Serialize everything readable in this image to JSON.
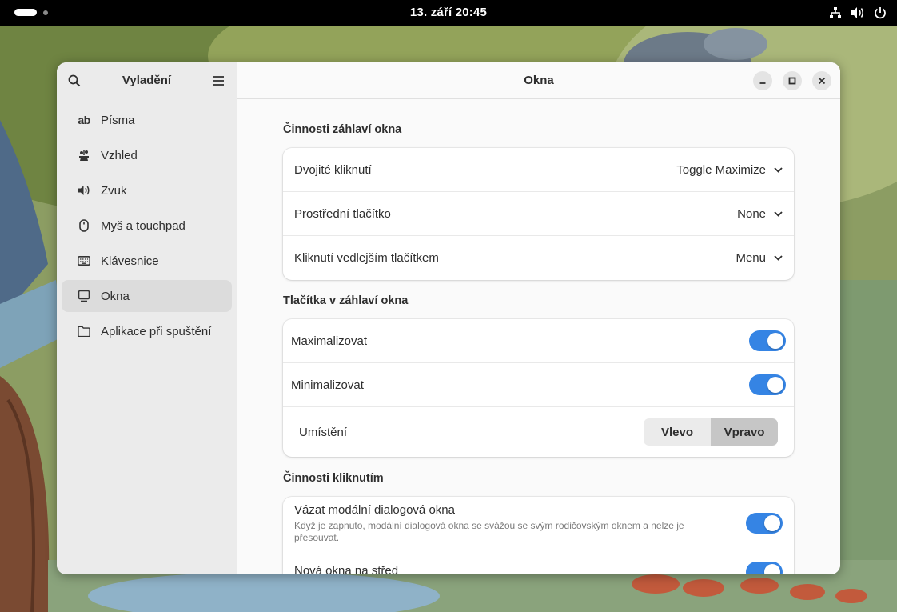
{
  "topbar": {
    "clock": "13. září  20:45",
    "tray_icons": [
      "network-icon",
      "volume-icon",
      "power-icon"
    ]
  },
  "sidebar": {
    "title": "Vyladění",
    "items": [
      {
        "label": "Písma",
        "icon": "ab-text-icon"
      },
      {
        "label": "Vzhled",
        "icon": "appearance-icon"
      },
      {
        "label": "Zvuk",
        "icon": "speaker-icon"
      },
      {
        "label": "Myš a touchpad",
        "icon": "mouse-icon"
      },
      {
        "label": "Klávesnice",
        "icon": "keyboard-icon"
      },
      {
        "label": "Okna",
        "icon": "window-icon"
      },
      {
        "label": "Aplikace při spuštění",
        "icon": "folder-icon"
      }
    ],
    "active_index": 5
  },
  "main": {
    "title": "Okna",
    "sections": {
      "titlebar_actions": {
        "title": "Činnosti záhlaví okna",
        "rows": [
          {
            "label": "Dvojité kliknutí",
            "value": "Toggle Maximize"
          },
          {
            "label": "Prostřední tlačítko",
            "value": "None"
          },
          {
            "label": "Kliknutí vedlejším tlačítkem",
            "value": "Menu"
          }
        ]
      },
      "titlebar_buttons": {
        "title": "Tlačítka v záhlaví okna",
        "maximize_label": "Maximalizovat",
        "maximize_on": true,
        "minimize_label": "Minimalizovat",
        "minimize_on": true,
        "placement_label": "Umístění",
        "placement_left": "Vlevo",
        "placement_right": "Vpravo",
        "placement_selected": "Vpravo"
      },
      "click_actions": {
        "title": "Činnosti kliknutím",
        "attach_modal_label": "Vázat modální dialogová okna",
        "attach_modal_desc": "Když je zapnuto, modální dialogová okna se svážou se svým rodičovským oknem a nelze je přesouvat.",
        "attach_modal_on": true,
        "center_new_label": "Nová okna na střed",
        "center_new_on": true
      }
    }
  },
  "colors": {
    "accent": "#3584e4",
    "topbar": "#000000",
    "window_bg": "#fafafa",
    "sidebar_bg": "#ebebeb"
  }
}
